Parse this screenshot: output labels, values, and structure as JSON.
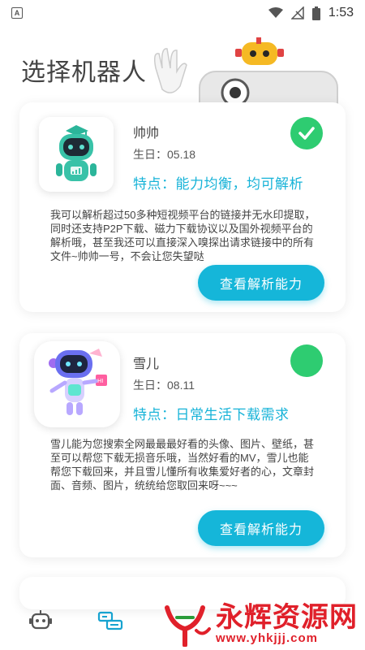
{
  "status_bar": {
    "time": "1:53"
  },
  "page": {
    "title": "选择机器人"
  },
  "robots": [
    {
      "name": "帅帅",
      "birthday": "生日：05.18",
      "feature": "特点：能力均衡，均可解析",
      "description": "我可以解析超过50多种短视频平台的链接并无水印提取，同时还支持P2P下载、磁力下载协议以及国外视频平台的解析哦，甚至我还可以直接深入嗅探出请求链接中的所有文件~帅帅一号，不会让您失望哒",
      "button": "查看解析能力",
      "selected": true
    },
    {
      "name": "雪儿",
      "birthday": "生日：08.11",
      "feature": "特点：日常生活下载需求",
      "description": "雪儿能为您搜索全网最最最好看的头像、图片、壁纸，甚至可以帮您下载无损音乐哦，当然好看的MV，雪儿也能帮您下载回来，并且雪儿懂所有收集爱好者的心，文章封面、音频、图片，统统给您取回来呀~~~",
      "button": "查看解析能力",
      "selected": false
    }
  ],
  "watermark": {
    "text": "永辉资源网",
    "url": "www.yhkjjj.com"
  },
  "colors": {
    "accent": "#15b6d9",
    "selected": "#2ecc71",
    "watermark": "#e0202a"
  }
}
